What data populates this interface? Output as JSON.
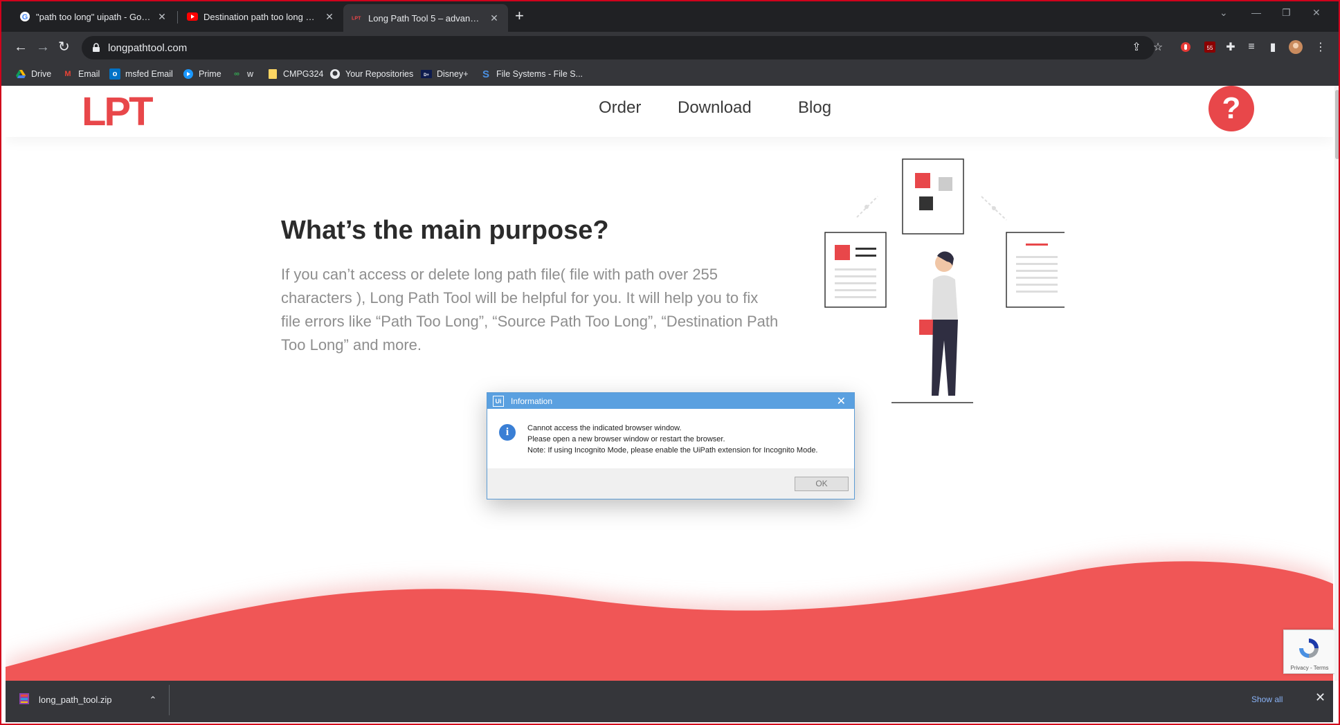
{
  "browser": {
    "tabs": [
      {
        "title": "\"path too long\" uipath - Google",
        "favicon": "google-icon"
      },
      {
        "title": "Destination path too long error w",
        "favicon": "youtube-icon"
      },
      {
        "title": "Long Path Tool 5 – advanced lon",
        "favicon": "lpt-icon"
      }
    ],
    "url": "longpathtool.com",
    "bookmarks": [
      "Drive",
      "Email",
      "msfed Email",
      "Prime",
      "w",
      "CMPG324",
      "Your Repositories",
      "Disney+",
      "File Systems - File S..."
    ]
  },
  "site": {
    "logo": "LPT",
    "nav": [
      "Order",
      "Download",
      "Blog"
    ],
    "help": "?",
    "headline": "What’s the main purpose?",
    "paragraph": "If you can’t access or delete long path file( file with path over 255 characters ), Long Path Tool will be helpful for you. It will help you to fix file errors like “Path Too Long”, “Source Path Too Long”, “Destination Path Too Long” and more.",
    "accent_color": "#e8474a"
  },
  "dialog": {
    "app_icon": "Ui",
    "title": "Information",
    "lines": [
      "Cannot access the indicated browser window.",
      "Please open a new browser window or restart the browser.",
      "Note: If using Incognito Mode, please enable the UiPath extension for Incognito Mode."
    ],
    "ok_label": "OK"
  },
  "recaptcha": {
    "footer": "Privacy - Terms"
  },
  "downloads": {
    "filename": "long_path_tool.zip",
    "show_all": "Show all"
  }
}
